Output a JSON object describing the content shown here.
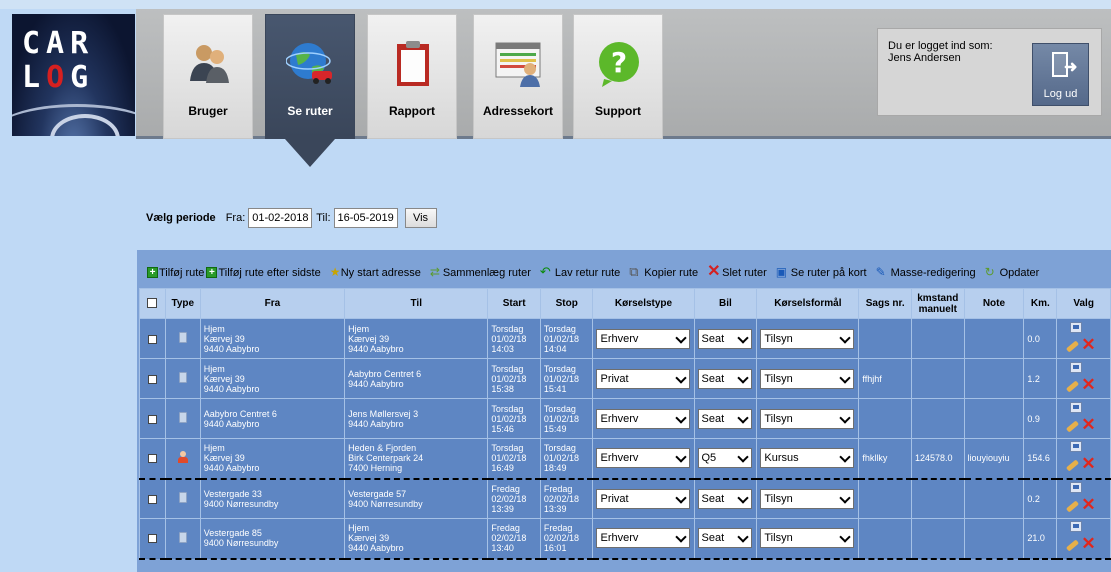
{
  "logo": {
    "line1": "CAR",
    "line2_c1": "L",
    "line2_c2": "O",
    "line2_c3": "G"
  },
  "nav": {
    "tabs": [
      {
        "label": "Bruger",
        "icon": "users-icon"
      },
      {
        "label": "Se ruter",
        "icon": "globe-car-icon",
        "active": true
      },
      {
        "label": "Rapport",
        "icon": "clipboard-icon"
      },
      {
        "label": "Adressekort",
        "icon": "address-card-icon"
      },
      {
        "label": "Support",
        "icon": "question-bubble-icon"
      }
    ]
  },
  "login": {
    "line1": "Du er logget ind som:",
    "user": "Jens Andersen",
    "logout_label": "Log ud"
  },
  "period": {
    "label": "Vælg periode",
    "from_label": "Fra:",
    "from_value": "01-02-2018",
    "to_label": "Til:",
    "to_value": "16-05-2019",
    "button": "Vis"
  },
  "toolbar": [
    {
      "label": "Tilføj rute",
      "icon": "add-icon"
    },
    {
      "label": "Tilføj rute efter sidste",
      "icon": "add-after-icon"
    },
    {
      "label": "Ny start adresse",
      "icon": "new-start-icon"
    },
    {
      "label": "Sammenlæg ruter",
      "icon": "merge-icon"
    },
    {
      "label": "Lav retur rute",
      "icon": "return-icon"
    },
    {
      "label": "Kopier rute",
      "icon": "copy-icon"
    },
    {
      "label": "Slet ruter",
      "icon": "delete-icon"
    },
    {
      "label": "Se ruter på kort",
      "icon": "map-icon"
    },
    {
      "label": "Masse-redigering",
      "icon": "mass-edit-icon"
    },
    {
      "label": "Opdater",
      "icon": "refresh-icon"
    }
  ],
  "table": {
    "headers": {
      "type": "Type",
      "fra": "Fra",
      "til": "Til",
      "start": "Start",
      "stop": "Stop",
      "korselstype": "Kørselstype",
      "bil": "Bil",
      "formaal": "Kørselsformål",
      "sags": "Sags nr.",
      "km_manuelt_1": "kmstand",
      "km_manuelt_2": "manuelt",
      "note": "Note",
      "km": "Km.",
      "valg": "Valg"
    },
    "rows": [
      {
        "type": "doc",
        "fra": [
          "Hjem",
          "Kærvej 39",
          "9440 Aabybro"
        ],
        "til": [
          "Hjem",
          "Kærvej 39",
          "9440 Aabybro"
        ],
        "start": [
          "Torsdag",
          "01/02/18",
          "14:03"
        ],
        "stop": [
          "Torsdag",
          "01/02/18",
          "14:04"
        ],
        "korselstype": "Erhverv",
        "bil": "Seat",
        "formaal": "Tilsyn",
        "sags": "",
        "km_manuelt": "",
        "note": "",
        "km": "0.0"
      },
      {
        "type": "doc",
        "fra": [
          "Hjem",
          "Kærvej 39",
          "9440 Aabybro"
        ],
        "til": [
          "Aabybro Centret 6",
          "9440 Aabybro"
        ],
        "start": [
          "Torsdag",
          "01/02/18",
          "15:38"
        ],
        "stop": [
          "Torsdag",
          "01/02/18",
          "15:41"
        ],
        "korselstype": "Privat",
        "bil": "Seat",
        "formaal": "Tilsyn",
        "sags": "ffhjhf",
        "km_manuelt": "",
        "note": "",
        "km": "1.2"
      },
      {
        "type": "doc",
        "fra": [
          "Aabybro Centret 6",
          "9440 Aabybro"
        ],
        "til": [
          "Jens Møllersvej 3",
          "9440 Aabybro"
        ],
        "start": [
          "Torsdag",
          "01/02/18",
          "15:46"
        ],
        "stop": [
          "Torsdag",
          "01/02/18",
          "15:49"
        ],
        "korselstype": "Erhverv",
        "bil": "Seat",
        "formaal": "Tilsyn",
        "sags": "",
        "km_manuelt": "",
        "note": "",
        "km": "0.9"
      },
      {
        "type": "person",
        "fra": [
          "Hjem",
          "Kærvej 39",
          "9440 Aabybro"
        ],
        "til": [
          "Heden & Fjorden",
          "Birk Centerpark 24",
          "7400 Herning"
        ],
        "start": [
          "Torsdag",
          "01/02/18",
          "16:49"
        ],
        "stop": [
          "Torsdag",
          "01/02/18",
          "18:49"
        ],
        "korselstype": "Erhverv",
        "bil": "Q5",
        "formaal": "Kursus",
        "sags": "fhkllky",
        "km_manuelt": "124578.0",
        "note": "liouyiouyiu",
        "km": "154.6"
      },
      {
        "type": "doc",
        "fra": [
          "Vestergade 33",
          "9400 Nørresundby"
        ],
        "til": [
          "Vestergade 57",
          "9400 Nørresundby"
        ],
        "start": [
          "Fredag",
          "02/02/18",
          "13:39"
        ],
        "stop": [
          "Fredag",
          "02/02/18",
          "13:39"
        ],
        "korselstype": "Privat",
        "bil": "Seat",
        "formaal": "Tilsyn",
        "sags": "",
        "km_manuelt": "",
        "note": "",
        "km": "0.2"
      },
      {
        "type": "doc",
        "fra": [
          "Vestergade 85",
          "9400 Nørresundby"
        ],
        "til": [
          "Hjem",
          "Kærvej 39",
          "9440 Aabybro"
        ],
        "start": [
          "Fredag",
          "02/02/18",
          "13:40"
        ],
        "stop": [
          "Fredag",
          "02/02/18",
          "16:01"
        ],
        "korselstype": "Erhverv",
        "bil": "Seat",
        "formaal": "Tilsyn",
        "sags": "",
        "km_manuelt": "",
        "note": "",
        "km": "21.0"
      }
    ]
  },
  "colors": {
    "header_band": "#a9abac",
    "active_tab": "#3a465a",
    "panel": "#7ea2d6",
    "row": "#5e86c3",
    "table_head": "#b7cfee",
    "page_bg": "#bfd9f5"
  }
}
